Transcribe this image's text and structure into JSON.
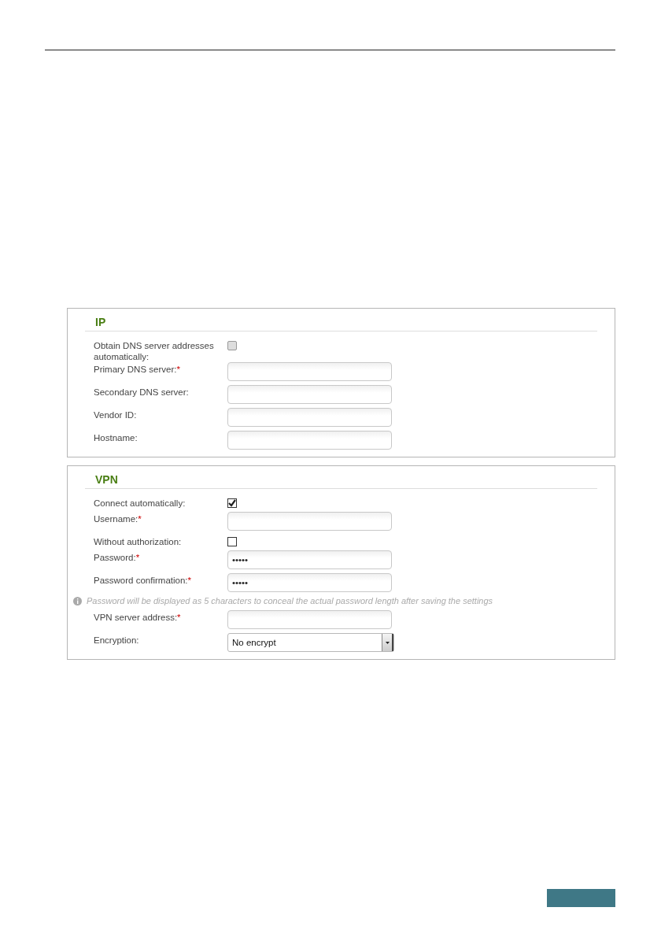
{
  "sections": [
    {
      "title": "IP",
      "rows": [
        {
          "kind": "checkbox",
          "label": "Obtain DNS server addresses automatically:",
          "checked": false
        },
        {
          "kind": "text",
          "label": "Primary DNS server:",
          "asterisk": "*"
        },
        {
          "kind": "text",
          "label": "Secondary DNS server:"
        },
        {
          "kind": "text",
          "label": "Vendor ID:"
        },
        {
          "kind": "text",
          "label": "Hostname:"
        }
      ]
    },
    {
      "title": "VPN",
      "rows": [
        {
          "kind": "checkbox",
          "label": "Connect automatically:",
          "checked": true
        },
        {
          "kind": "text",
          "label": "Username:",
          "asterisk": "*"
        },
        {
          "kind": "checkbox",
          "label": "Without authorization:",
          "checked": false
        },
        {
          "kind": "password",
          "label": "Password:",
          "asterisk": "*",
          "value": "•••••"
        },
        {
          "kind": "password",
          "label": "Password confirmation:",
          "asterisk": "*",
          "value": "•••••"
        },
        {
          "kind": "note",
          "text": "Password will be displayed as 5 characters to conceal the actual password length after saving the settings"
        },
        {
          "kind": "text",
          "label": "VPN server address:",
          "asterisk": "*"
        },
        {
          "kind": "select",
          "label": "Encryption:",
          "value": "No encrypt"
        }
      ]
    }
  ]
}
